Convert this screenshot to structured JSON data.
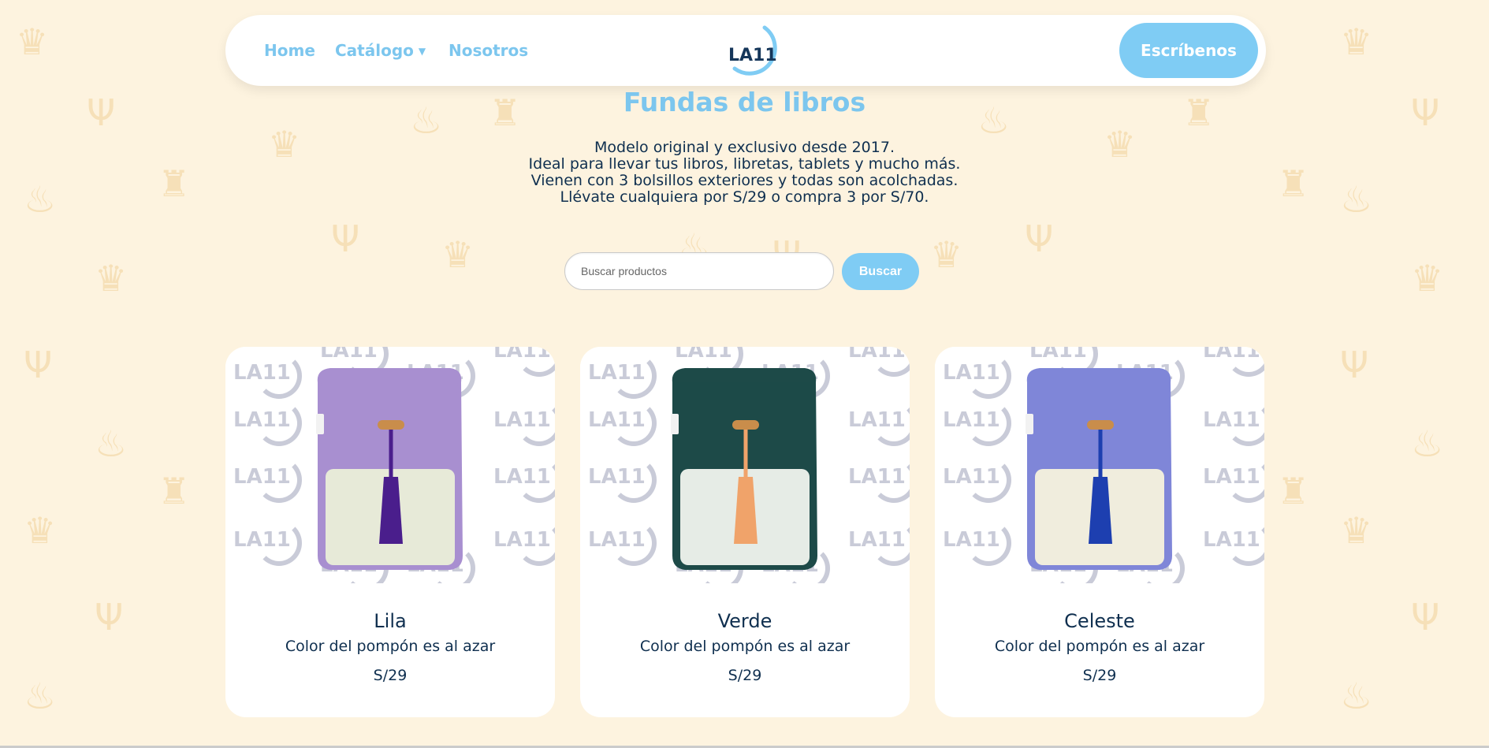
{
  "nav": {
    "home": "Home",
    "catalogo": "Catálogo",
    "nosotros": "Nosotros",
    "cta": "Escríbenos",
    "logo_text": "LA11"
  },
  "page": {
    "title": "Fundas de libros",
    "description": [
      "Modelo original y exclusivo desde 2017.",
      "Ideal para llevar tus libros, libretas, tablets y mucho más.",
      "Vienen con 3 bolsillos exteriores y todas son acolchadas.",
      "Llévate cualquiera por S/29 o compra 3 por S/70."
    ]
  },
  "search": {
    "placeholder": "Buscar productos",
    "button": "Buscar"
  },
  "products": [
    {
      "name": "Lila",
      "desc": "Color del pompón es al azar",
      "price": "S/29",
      "body_color": "#a88fd0",
      "pocket_color": "#e7ead8",
      "tassel_color": "#4a1e8c"
    },
    {
      "name": "Verde",
      "desc": "Color del pompón es al azar",
      "price": "S/29",
      "body_color": "#1d4a48",
      "pocket_color": "#e6ece6",
      "tassel_color": "#f0a36a"
    },
    {
      "name": "Celeste",
      "desc": "Color del pompón es al azar",
      "price": "S/29",
      "body_color": "#7f86d8",
      "pocket_color": "#f0eddd",
      "tassel_color": "#1d3fb0"
    }
  ],
  "colors": {
    "accent": "#7fccf4",
    "text": "#0f2f4f",
    "background": "#fdf3df"
  }
}
